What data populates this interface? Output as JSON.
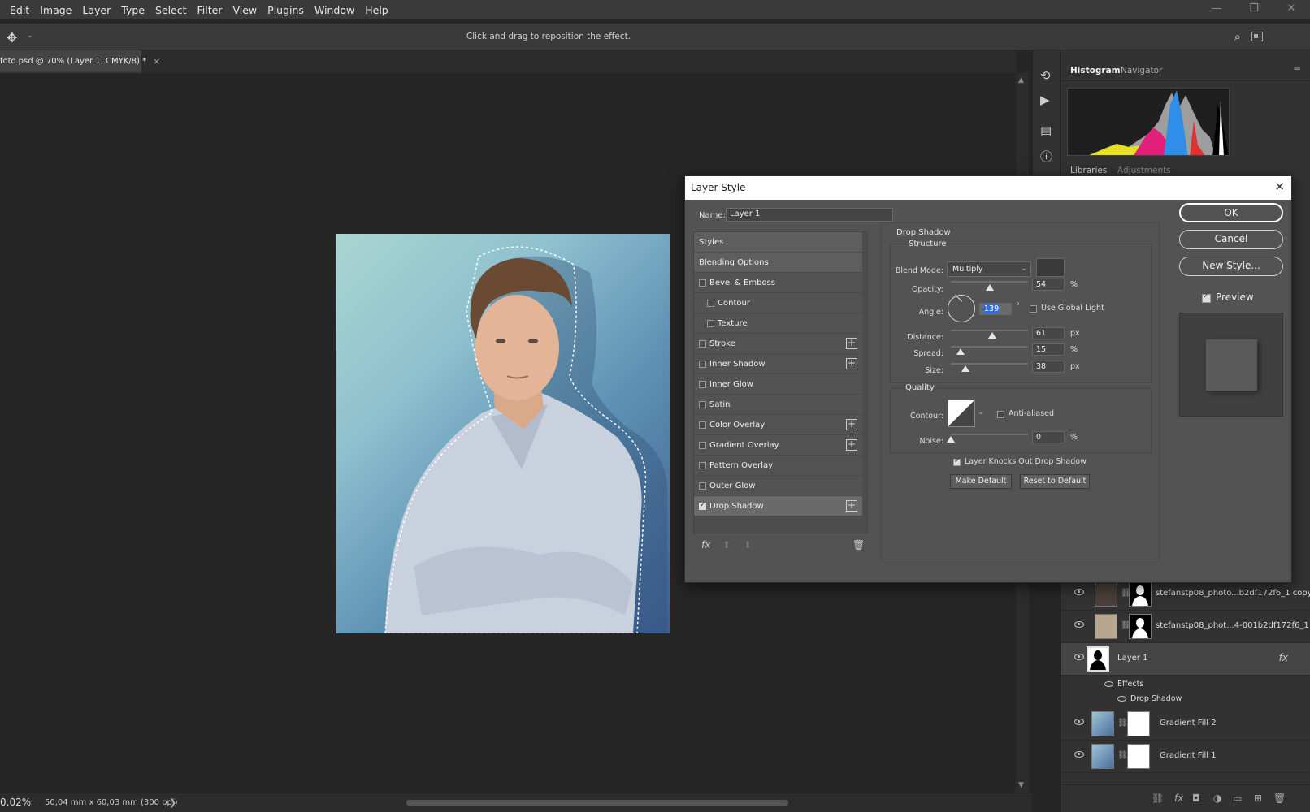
{
  "menu": [
    "Edit",
    "Image",
    "Layer",
    "Type",
    "Select",
    "Filter",
    "View",
    "Plugins",
    "Window",
    "Help"
  ],
  "window_controls": [
    "—",
    "❐",
    "✕"
  ],
  "options_bar": {
    "hint": "Click and drag to reposition the effect."
  },
  "doc_tab": {
    "label": "foto.psd @ 70% (Layer 1, CMYK/8) *",
    "close": "×"
  },
  "status": {
    "zoom": "0.02%",
    "doc_size": "50,04 mm x 60,03 mm (300 ppi)",
    "arrow": "❯"
  },
  "panels": {
    "histogram_tab": "Histogram",
    "navigator_tab": "Navigator",
    "libraries_tab": "Libraries",
    "adjustments_tab": "Adjustments",
    "menu_icon": "≡"
  },
  "layers": [
    {
      "name": "stefanstp08_photo...b2df172f6_1 copy"
    },
    {
      "name": "stefanstp08_phot...4-001b2df172f6_1"
    },
    {
      "name": "Layer 1",
      "fx": "fx",
      "effects_label": "Effects",
      "effect": "Drop Shadow"
    },
    {
      "name": "Gradient Fill 2"
    },
    {
      "name": "Gradient Fill 1"
    }
  ],
  "dialog": {
    "title": "Layer Style",
    "close": "✕",
    "name_label": "Name:",
    "name_value": "Layer 1",
    "styles": [
      {
        "label": "Styles",
        "type": "header"
      },
      {
        "label": "Blending Options",
        "type": "header"
      },
      {
        "label": "Bevel & Emboss",
        "checked": false
      },
      {
        "label": "Contour",
        "checked": false,
        "indent": true
      },
      {
        "label": "Texture",
        "checked": false,
        "indent": true
      },
      {
        "label": "Stroke",
        "checked": false,
        "plus": true
      },
      {
        "label": "Inner Shadow",
        "checked": false,
        "plus": true
      },
      {
        "label": "Inner Glow",
        "checked": false
      },
      {
        "label": "Satin",
        "checked": false
      },
      {
        "label": "Color Overlay",
        "checked": false,
        "plus": true
      },
      {
        "label": "Gradient Overlay",
        "checked": false,
        "plus": true
      },
      {
        "label": "Pattern Overlay",
        "checked": false
      },
      {
        "label": "Outer Glow",
        "checked": false
      },
      {
        "label": "Drop Shadow",
        "checked": true,
        "plus": true,
        "selected": true
      }
    ],
    "footer": {
      "fx": "fx",
      "up": "⬆",
      "down": "⬇",
      "trash": "🗑"
    },
    "drop_shadow": {
      "section_title": "Drop Shadow",
      "structure_title": "Structure",
      "blend_mode_label": "Blend Mode:",
      "blend_mode_value": "Multiply",
      "shadow_color": "#3a3a3a",
      "opacity_label": "Opacity:",
      "opacity_value": "54",
      "opacity_unit": "%",
      "angle_label": "Angle:",
      "angle_value": "139",
      "angle_unit": "°",
      "use_global_light": "Use Global Light",
      "distance_label": "Distance:",
      "distance_value": "61",
      "distance_unit": "px",
      "spread_label": "Spread:",
      "spread_value": "15",
      "spread_unit": "%",
      "size_label": "Size:",
      "size_value": "38",
      "size_unit": "px",
      "quality_title": "Quality",
      "contour_label": "Contour:",
      "anti_aliased": "Anti-aliased",
      "noise_label": "Noise:",
      "noise_value": "0",
      "noise_unit": "%",
      "layer_knocks_out": "Layer Knocks Out Drop Shadow",
      "make_default": "Make Default",
      "reset_default": "Reset to Default"
    },
    "buttons": {
      "ok": "OK",
      "cancel": "Cancel",
      "new_style": "New Style...",
      "preview": "Preview"
    }
  }
}
